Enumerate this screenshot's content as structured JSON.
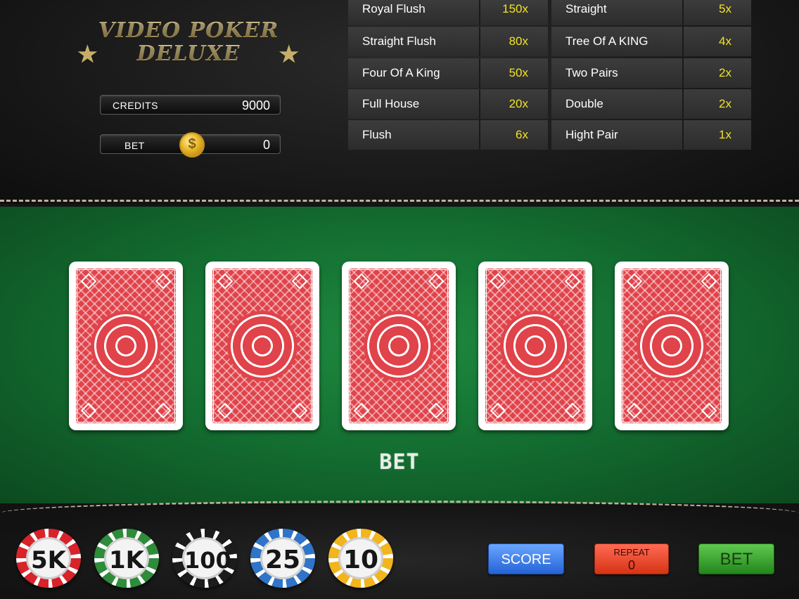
{
  "logo": {
    "line1": "VIDEO POKER",
    "line2": "DELUXE",
    "star": "★"
  },
  "credits": {
    "label": "CREDITS",
    "value": "9000"
  },
  "bet": {
    "label": "BET",
    "value": "0",
    "coin_symbol": "$"
  },
  "paytable": {
    "left": [
      {
        "hand": "Royal Flush",
        "multiplier": "150x"
      },
      {
        "hand": "Straight Flush",
        "multiplier": "80x"
      },
      {
        "hand": "Four Of A King",
        "multiplier": "50x"
      },
      {
        "hand": "Full House",
        "multiplier": "20x"
      },
      {
        "hand": "Flush",
        "multiplier": "6x"
      }
    ],
    "right": [
      {
        "hand": "Straight",
        "multiplier": "5x"
      },
      {
        "hand": "Tree Of A KING",
        "multiplier": "4x"
      },
      {
        "hand": "Two Pairs",
        "multiplier": "2x"
      },
      {
        "hand": "Double",
        "multiplier": "2x"
      },
      {
        "hand": "Hight Pair",
        "multiplier": "1x"
      }
    ]
  },
  "table": {
    "status_text": "BET",
    "card_count": 5,
    "cards_face": "down"
  },
  "chips": [
    {
      "label": "5K",
      "color": "#d8232a"
    },
    {
      "label": "1K",
      "color": "#2e8c3a"
    },
    {
      "label": "100",
      "color": "#1c1c1c"
    },
    {
      "label": "25",
      "color": "#2f74c9"
    },
    {
      "label": "10",
      "color": "#f2b51e"
    }
  ],
  "buttons": {
    "score": "SCORE",
    "repeat_label": "REPEAT",
    "repeat_value": "0",
    "bet": "BET"
  },
  "colors": {
    "felt": "#147032",
    "card_back": "#e0434a",
    "multiplier": "#f2e22a"
  }
}
